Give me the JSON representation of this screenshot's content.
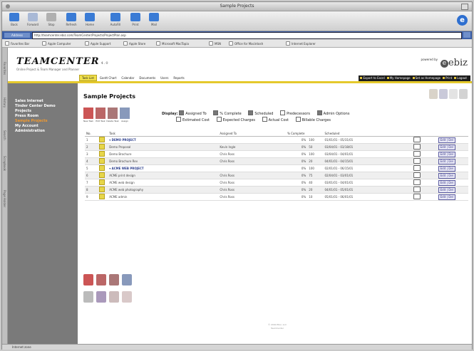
{
  "window": {
    "title": "Sample Projects"
  },
  "toolbar": {
    "buttons": [
      {
        "label": "Back",
        "icon": "back-arrow-icon"
      },
      {
        "label": "Forward",
        "icon": "forward-arrow-icon"
      },
      {
        "label": "Stop",
        "icon": "stop-icon"
      },
      {
        "label": "Refresh",
        "icon": "refresh-icon"
      },
      {
        "label": "Home",
        "icon": "home-icon"
      },
      {
        "label": "AutoFill",
        "icon": "autofill-icon"
      },
      {
        "label": "Print",
        "icon": "print-icon"
      },
      {
        "label": "Mail",
        "icon": "mail-icon"
      }
    ]
  },
  "addressbar": {
    "label": "Address",
    "url": "http://teamcenter.ebiz.com/TeamCenter/Projects/ProjectPlan.asp"
  },
  "favorites": [
    "Favorites Bar",
    "Apple Computer",
    "Apple Support",
    "Apple Store",
    "Microsoft MacTopia",
    "MSN",
    "Office for Macintosh",
    "Internet Explorer"
  ],
  "side_tabs": [
    "Favorites",
    "History",
    "Search",
    "Scrapbook",
    "Page Holder"
  ],
  "app": {
    "brand": "TEAMCENTER",
    "version": "4.0",
    "tagline": "Online Project & Team Manager and Planner",
    "powered_by": "powered by",
    "vendor": "ebiz",
    "tabs": [
      "Task List",
      "Gantt Chart",
      "Calendar",
      "Documents",
      "Users",
      "Reports"
    ],
    "active_tab": "Task List",
    "user_links": [
      "Export to Excel",
      "My Homepage",
      "Set as Homepage",
      "Print",
      "Logout"
    ]
  },
  "sidebar": {
    "items": [
      {
        "label": "Sales Internet",
        "active": false
      },
      {
        "label": "Tinder Center Demo",
        "active": false
      },
      {
        "label": "Projects",
        "active": false
      },
      {
        "label": "Press Room",
        "active": false
      },
      {
        "label": "Sample Projects",
        "active": true
      },
      {
        "label": "My Account",
        "active": false
      },
      {
        "label": "Administration",
        "active": false
      }
    ]
  },
  "main": {
    "title": "Sample Projects",
    "actions": [
      {
        "label": "New Task",
        "icon": "new-task-icon"
      },
      {
        "label": "Edit Task",
        "icon": "edit-task-icon"
      },
      {
        "label": "Delete Task",
        "icon": "delete-task-icon"
      },
      {
        "label": "Assign",
        "icon": "assign-user-icon"
      }
    ],
    "display_label": "Display:",
    "display_options_row1": [
      {
        "label": "Assigned To",
        "checked": true
      },
      {
        "label": "% Complete",
        "checked": true
      },
      {
        "label": "Scheduled",
        "checked": true
      },
      {
        "label": "Predecessors",
        "checked": false
      },
      {
        "label": "Admin Options",
        "checked": true
      }
    ],
    "display_options_row2": [
      {
        "label": "Estimated Cost",
        "checked": false
      },
      {
        "label": "Expected Charges",
        "checked": false
      },
      {
        "label": "Actual Cost",
        "checked": false
      },
      {
        "label": "Billable Charges",
        "checked": false
      }
    ]
  },
  "grid": {
    "headers": [
      "No.",
      "Task",
      "Assigned To",
      "% Complete",
      "Scheduled",
      "",
      ""
    ],
    "rows": [
      {
        "no": "1",
        "task": "DEMO PROJECT",
        "group": true,
        "assigned": "",
        "pct_a": "0%",
        "pct_b": "100",
        "dates": "01/01/01 - 05/31/01"
      },
      {
        "no": "2",
        "task": "Demo Proposal",
        "group": false,
        "assigned": "Kevin Ingle",
        "pct_a": "0%",
        "pct_b": "50",
        "dates": "03/04/01 - 03/18/01"
      },
      {
        "no": "3",
        "task": "Demo Brochure",
        "group": false,
        "assigned": "Chris Ross",
        "pct_a": "0%",
        "pct_b": "100",
        "dates": "03/04/01 - 04/01/01"
      },
      {
        "no": "4",
        "task": "Demo Brochure Rev",
        "group": false,
        "assigned": "Chris Ross",
        "pct_a": "0%",
        "pct_b": "20",
        "dates": "04/01/01 - 04/15/01"
      },
      {
        "no": "5",
        "task": "ACME WEB PROJECT",
        "group": true,
        "assigned": "",
        "pct_a": "0%",
        "pct_b": "100",
        "dates": "02/01/01 - 06/15/01"
      },
      {
        "no": "6",
        "task": "ACME print design",
        "group": false,
        "assigned": "Chris Ross",
        "pct_a": "0%",
        "pct_b": "75",
        "dates": "02/04/01 - 03/01/01"
      },
      {
        "no": "7",
        "task": "ACME web design",
        "group": false,
        "assigned": "Chris Ross",
        "pct_a": "0%",
        "pct_b": "40",
        "dates": "03/01/01 - 04/01/01"
      },
      {
        "no": "8",
        "task": "ACME web photography",
        "group": false,
        "assigned": "Chris Ross",
        "pct_a": "0%",
        "pct_b": "20",
        "dates": "04/01/01 - 05/01/01"
      },
      {
        "no": "9",
        "task": "ACME admin",
        "group": false,
        "assigned": "Chris Ross",
        "pct_a": "0%",
        "pct_b": "10",
        "dates": "05/01/01 - 06/01/01"
      }
    ],
    "row_button": "Edit | Del"
  },
  "footer": {
    "line1": "© 2000 Ebiz, LLC",
    "line2": "TeamCenter"
  },
  "status": {
    "text": "Internet zone"
  },
  "colors": {
    "sidebar_bg": "#7a7a7a",
    "sidebar_active": "#f29a2f",
    "tab_active": "#f0e04c",
    "address_bar": "#3b5fa8"
  }
}
